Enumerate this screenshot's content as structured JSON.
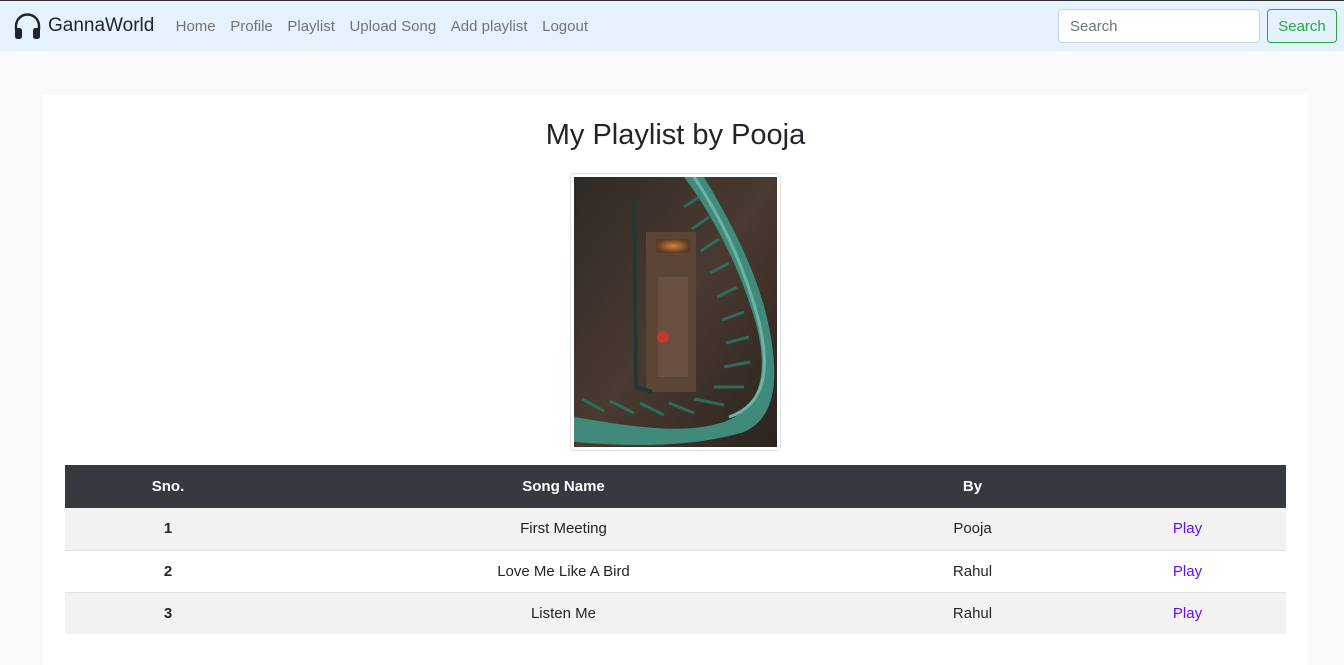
{
  "navbar": {
    "brand": "GannaWorld",
    "links": [
      "Home",
      "Profile",
      "Playlist",
      "Upload Song",
      "Add playlist",
      "Logout"
    ],
    "search_placeholder": "Search",
    "search_button": "Search"
  },
  "page": {
    "title": "My Playlist by Pooja"
  },
  "table": {
    "headers": [
      "Sno.",
      "Song Name",
      "By",
      ""
    ],
    "rows": [
      {
        "sno": "1",
        "song": "First Meeting",
        "by": "Pooja",
        "action": "Play"
      },
      {
        "sno": "2",
        "song": "Love Me Like A Bird",
        "by": "Rahul",
        "action": "Play"
      },
      {
        "sno": "3",
        "song": "Listen Me",
        "by": "Rahul",
        "action": "Play"
      }
    ]
  },
  "icons": {
    "brand_icon": "headphones-icon"
  }
}
